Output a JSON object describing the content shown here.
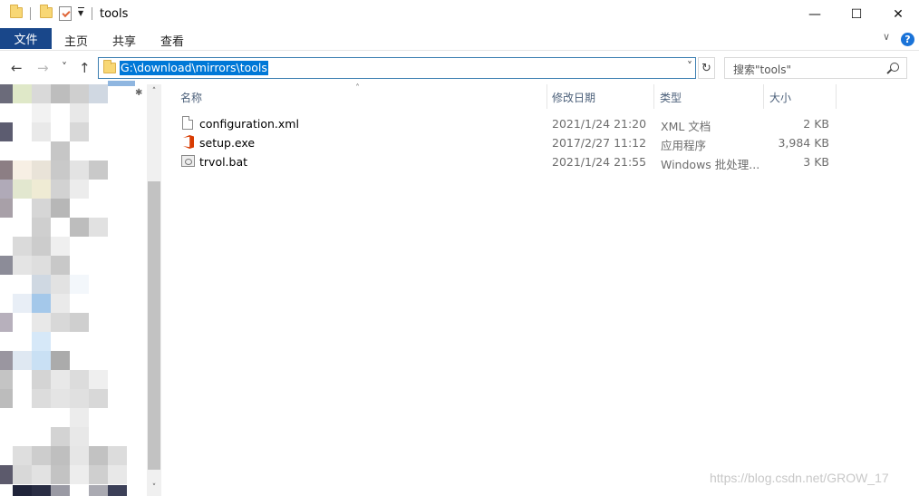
{
  "window": {
    "title": "tools",
    "minimize_glyph": "—",
    "maximize_glyph": "☐",
    "close_glyph": "✕"
  },
  "ribbon": {
    "file_tab": "文件",
    "tabs": [
      "主页",
      "共享",
      "查看"
    ],
    "expand_glyph": "∨",
    "help_glyph": "?"
  },
  "navigation": {
    "back_glyph": "←",
    "forward_glyph": "→",
    "recent_glyph": "˅",
    "up_glyph": "↑",
    "address": "G:\\download\\mirrors\\tools",
    "address_dropdown_glyph": "˅",
    "refresh_glyph": "↻",
    "search_placeholder": "搜索\"tools\""
  },
  "columns": {
    "name": "名称",
    "date": "修改日期",
    "type": "类型",
    "size": "大小",
    "sort_glyph": "˄"
  },
  "files": [
    {
      "name": "configuration.xml",
      "date": "2021/1/24 21:20",
      "type": "XML 文档",
      "size": "2 KB",
      "icon": "xml-file-icon"
    },
    {
      "name": "setup.exe",
      "date": "2017/2/27 11:12",
      "type": "应用程序",
      "size": "3,984 KB",
      "icon": "office-setup-icon"
    },
    {
      "name": "trvol.bat",
      "date": "2021/1/24 21:55",
      "type": "Windows 批处理...",
      "size": "3 KB",
      "icon": "batch-file-icon"
    }
  ],
  "scrollbar": {
    "up_glyph": "˄",
    "down_glyph": "˅"
  },
  "watermark": "https://blog.csdn.net/GROW_17",
  "colors": {
    "file_tab_bg": "#19478a",
    "selection": "#0078d7",
    "address_border": "#3c7fb1",
    "column_header_text": "#4c607a"
  }
}
